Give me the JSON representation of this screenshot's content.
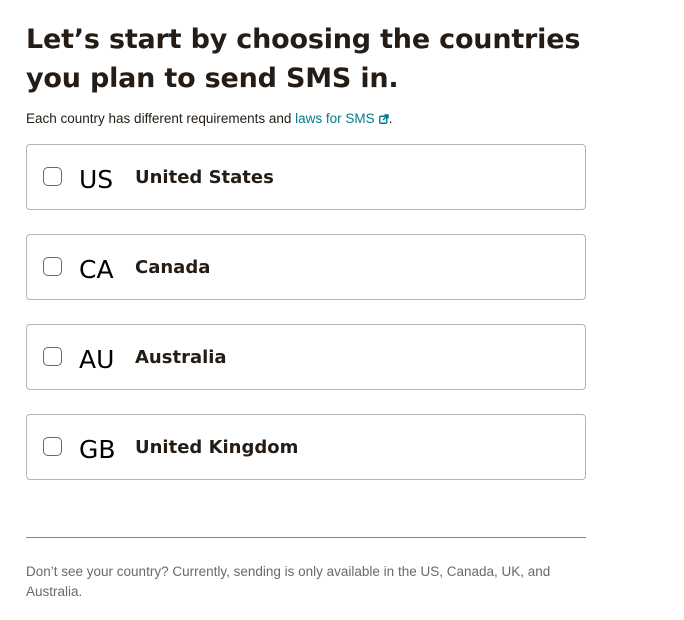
{
  "heading": "Let’s start by choosing the countries you plan to send SMS in.",
  "subtext": {
    "prefix": "Each country has different requirements and ",
    "link_label": "laws for SMS",
    "suffix": ".",
    "link_icon": "external-link-icon"
  },
  "countries": [
    {
      "code": "US",
      "name": "United States",
      "checked": false
    },
    {
      "code": "CA",
      "name": "Canada",
      "checked": false
    },
    {
      "code": "AU",
      "name": "Australia",
      "checked": false
    },
    {
      "code": "GB",
      "name": "United Kingdom",
      "checked": false
    }
  ],
  "footnote": "Don’t see your country? Currently, sending is only available in the US, Canada, UK, and Australia.",
  "colors": {
    "text": "#241c15",
    "link": "#007c89",
    "border": "#b7b5b3",
    "muted": "#6b6968"
  }
}
